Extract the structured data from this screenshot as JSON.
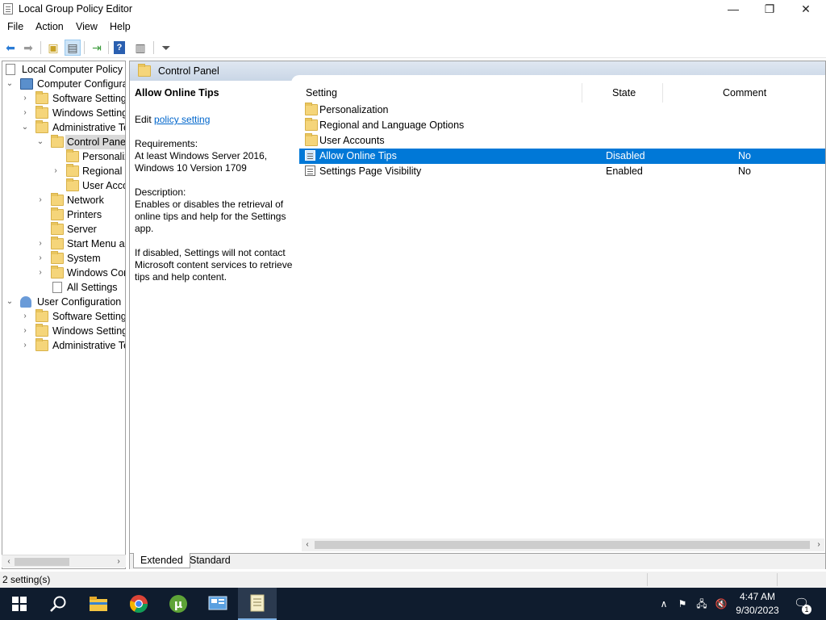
{
  "window": {
    "title": "Local Group Policy Editor"
  },
  "menu": [
    "File",
    "Action",
    "View",
    "Help"
  ],
  "tree": {
    "root": "Local Computer Policy",
    "computer_config": "Computer Configura",
    "cc_software": "Software Settings",
    "cc_windows": "Windows Setting",
    "cc_admin": "Administrative Te",
    "control_panel": "Control Panel",
    "cp_personalization": "Personaliz",
    "cp_regional": "Regional a",
    "cp_user_accounts": "User Acco",
    "network": "Network",
    "printers": "Printers",
    "server": "Server",
    "start_menu": "Start Menu ar",
    "system": "System",
    "windows_components": "Windows Cor",
    "all_settings": "All Settings",
    "user_config": "User Configuration",
    "uc_software": "Software Settings",
    "uc_windows": "Windows Setting",
    "uc_admin": "Administrative Te"
  },
  "right": {
    "header_title": "Control Panel",
    "desc_title": "Allow Online Tips",
    "edit_prefix": "Edit",
    "edit_link": "policy setting",
    "requirements_label": "Requirements:",
    "requirements_text": "At least Windows Server 2016, Windows 10 Version 1709",
    "description_label": "Description:",
    "description_text": "Enables or disables the retrieval of online tips and help for the Settings app.",
    "disabled_text": "If disabled, Settings will not contact Microsoft content services to retrieve tips and help content.",
    "columns": {
      "setting": "Setting",
      "state": "State",
      "comment": "Comment"
    },
    "rows": [
      {
        "name": "Personalization",
        "state": "",
        "comment": "",
        "icon": "folder-icon"
      },
      {
        "name": "Regional and Language Options",
        "state": "",
        "comment": "",
        "icon": "folder-icon"
      },
      {
        "name": "User Accounts",
        "state": "",
        "comment": "",
        "icon": "folder-icon"
      },
      {
        "name": "Allow Online Tips",
        "state": "Disabled",
        "comment": "No",
        "icon": "policy-setting-icon"
      },
      {
        "name": "Settings Page Visibility",
        "state": "Enabled",
        "comment": "No",
        "icon": "policy-setting-icon"
      }
    ],
    "tabs": [
      "Extended",
      "Standard"
    ]
  },
  "status": {
    "text": "2 setting(s)"
  },
  "taskbar": {
    "time": "4:47 AM",
    "date": "9/30/2023",
    "notification_count": "1"
  },
  "colors": {
    "selection": "#0078d7",
    "taskbar": "#0f1c2e",
    "folder": "#f5d57a"
  }
}
